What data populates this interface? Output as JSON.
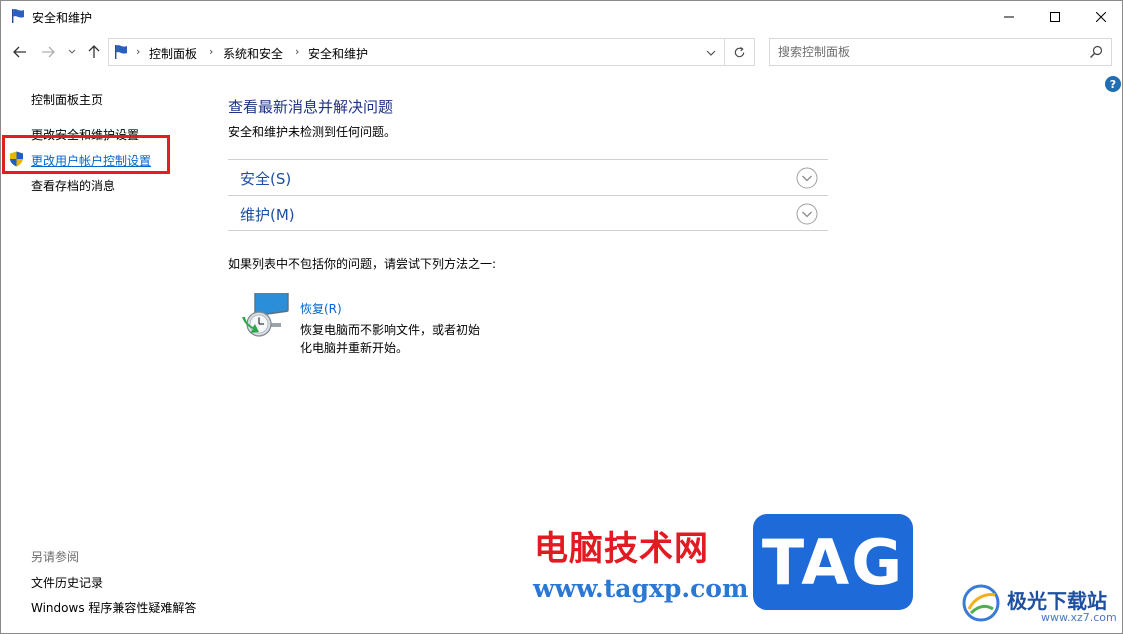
{
  "window": {
    "title": "安全和维护"
  },
  "navigation": {
    "breadcrumbs": [
      "控制面板",
      "系统和安全",
      "安全和维护"
    ],
    "search_placeholder": "搜索控制面板"
  },
  "help": {
    "glyph": "?"
  },
  "left_pane": {
    "links": [
      "控制面板主页",
      "更改安全和维护设置",
      "更改用户帐户控制设置",
      "查看存档的消息"
    ],
    "see_also": {
      "title": "另请参阅",
      "links": [
        "文件历史记录",
        "Windows 程序兼容性疑难解答"
      ]
    }
  },
  "main": {
    "heading": "查看最新消息并解决问题",
    "status": "安全和维护未检测到任何问题。",
    "sections": [
      "安全(S)",
      "维护(M)"
    ],
    "try_text": "如果列表中不包括你的问题，请尝试下列方法之一:",
    "recovery": {
      "link": "恢复(R)",
      "desc_line1": "恢复电脑而不影响文件，或者初始",
      "desc_line2": "化电脑并重新开始。"
    }
  },
  "watermark": {
    "site_name": "电脑技术网",
    "site_url": "www.tagxp.com",
    "tag": "TAG",
    "logo_text": "极光下载站",
    "logo_url": "www.xz7.com"
  },
  "colors": {
    "link": "#0066cc",
    "heading": "#1e3287",
    "highlight": "#e02020",
    "watermark_red": "#e21a22",
    "watermark_blue": "#1e6ad8"
  }
}
